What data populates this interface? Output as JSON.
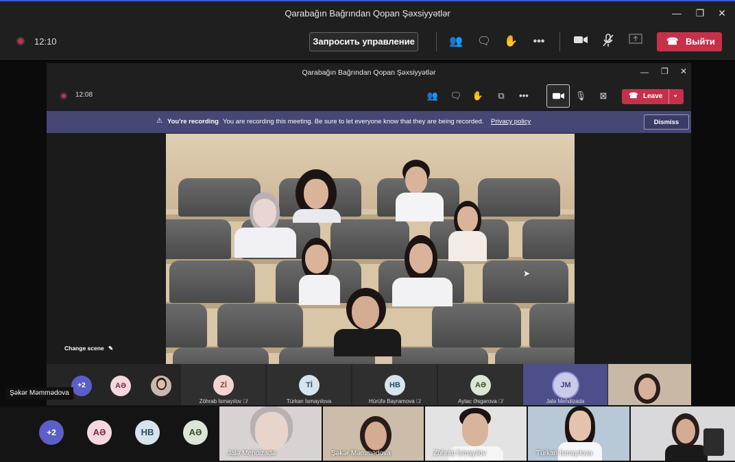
{
  "outer": {
    "title": "Qarabağın Bağrından Qopan Şəxsiyyətlər",
    "time": "12:10",
    "request_control": "Запросить управление",
    "leave": "Выйти"
  },
  "inner": {
    "title": "Qarabağın Bağrından Qopan Şəxsiyyətlər",
    "time": "12:08",
    "leave": "Leave"
  },
  "banner": {
    "title": "You're recording",
    "message": "You are recording this meeting. Be sure to let everyone know that they are being recorded.",
    "link": "Privacy policy",
    "dismiss": "Dismiss"
  },
  "change_scene": "Change scene",
  "strip1": {
    "overflow": "+2",
    "initials_ae": "AƏ",
    "tiles": [
      {
        "initials": "Zİ",
        "name": "Zöhrab İsmayılov"
      },
      {
        "initials": "Tİ",
        "name": "Türkan İsmayılova"
      },
      {
        "initials": "HB",
        "name": "Hürüfə Bayramova"
      },
      {
        "initials": "AƏ",
        "name": "Aytac Əsgərova"
      },
      {
        "initials": "JM",
        "name": "Jalə Mehdizadə"
      }
    ]
  },
  "hover_label": "Şəkər Məmmədova",
  "strip2": {
    "overflow": "+2",
    "initials": [
      "AƏ",
      "HB",
      "AƏ"
    ],
    "videos": [
      {
        "name": "Jalə Mehdizadə"
      },
      {
        "name": "Şəkər Məmmədova"
      },
      {
        "name": "Zöhrab İsmayılov"
      },
      {
        "name": "Türkan İsmayılova"
      },
      {
        "name": ""
      }
    ]
  },
  "colors": {
    "accent": "#c4314b",
    "banner": "#464775",
    "avatar_purple": "#5b5fc7",
    "avatar_pink": "#f7d7de",
    "avatar_blue": "#d6e4ee",
    "avatar_green": "#dde5d7"
  }
}
